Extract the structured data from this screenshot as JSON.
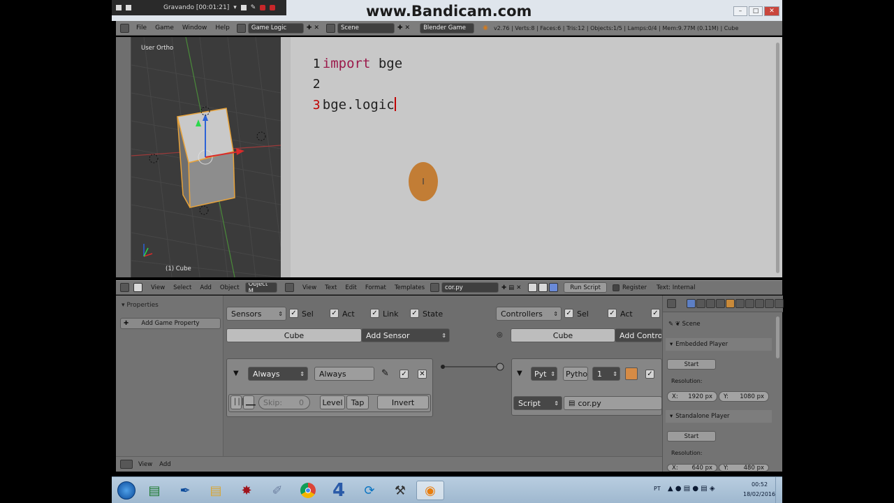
{
  "recording": {
    "label": "Gravando [00:01:21]"
  },
  "watermark": "www.Bandicam.com",
  "window_buttons": {
    "minimize": "–",
    "maximize": "□",
    "close": "✕"
  },
  "top_header": {
    "menus": [
      "File",
      "Game",
      "Window",
      "Help"
    ],
    "screen_layout": "Game Logic",
    "scene": "Scene",
    "engine": "Blender Game",
    "stats": "v2.76 | Verts:8 | Faces:6 | Tris:12 | Objects:1/5 | Lamps:0/4 | Mem:9.77M (0.11M) | Cube"
  },
  "viewport": {
    "view_label": "User Ortho",
    "object_label": "(1) Cube"
  },
  "viewport_header": {
    "menus": [
      "View",
      "Select",
      "Add",
      "Object"
    ],
    "mode": "Object M"
  },
  "text_editor": {
    "lines": [
      {
        "num": "1",
        "keyword": "import",
        "rest": " bge"
      },
      {
        "num": "2",
        "keyword": "",
        "rest": ""
      },
      {
        "num": "3",
        "keyword": "",
        "rest": "bge.logic"
      }
    ],
    "cursor_glyph": "I"
  },
  "text_header": {
    "menus": [
      "View",
      "Text",
      "Edit",
      "Format",
      "Templates"
    ],
    "file": "cor.py",
    "run_script": "Run Script",
    "register": "Register",
    "source": "Text: Internal"
  },
  "logic": {
    "properties_title": "Properties",
    "add_game_property": "Add Game Property",
    "sensors": {
      "dropdown": "Sensors",
      "filters": [
        "Sel",
        "Act",
        "Link",
        "State"
      ],
      "object": "Cube",
      "add": "Add Sensor",
      "type": "Always",
      "name": "Always",
      "skip_label": "Skip:",
      "skip_value": "0",
      "level": "Level",
      "tap": "Tap",
      "invert": "Invert"
    },
    "controllers": {
      "dropdown": "Controllers",
      "filters": [
        "Sel",
        "Act"
      ],
      "object": "Cube",
      "add": "Add Controlle",
      "type": "Pyt",
      "name": "Pytho",
      "state": "1",
      "mode": "Script",
      "script": "cor.py"
    },
    "footer": {
      "menus": [
        "View",
        "Add"
      ]
    }
  },
  "properties": {
    "context": "Scene",
    "embedded_title": "Embedded Player",
    "embedded_start": "Start",
    "embedded_resolution_label": "Resolution:",
    "embedded_x": "1920 px",
    "embedded_y": "1080 px",
    "standalone_title": "Standalone Player",
    "standalone_start": "Start",
    "standalone_resolution_label": "Resolution:",
    "standalone_x": "640 px",
    "standalone_y": "480 px",
    "x_label": "X:",
    "y_label": "Y:"
  },
  "taskbar": {
    "lang": "PT",
    "time": "00:52",
    "date": "18/02/2016",
    "app4_label": "4"
  }
}
